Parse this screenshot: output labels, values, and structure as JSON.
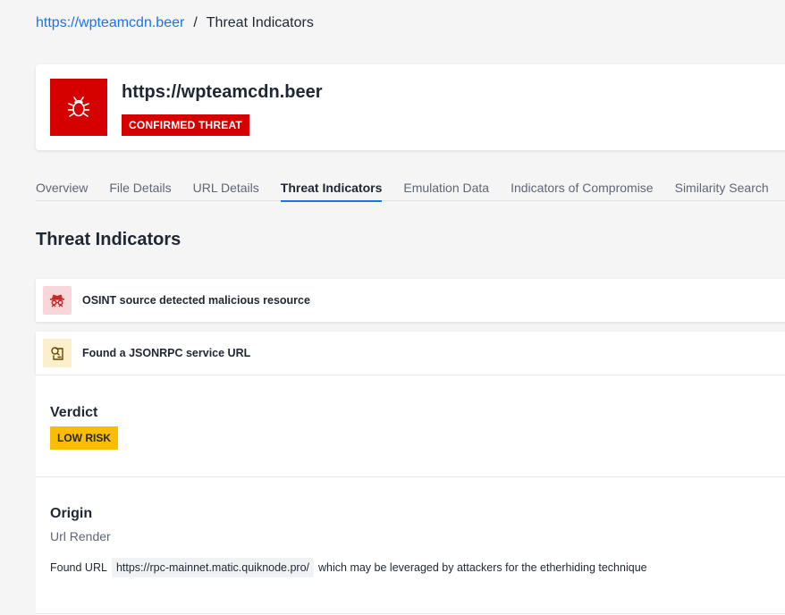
{
  "breadcrumb": {
    "link": "https://wpteamcdn.beer",
    "separator": "/",
    "current": "Threat Indicators"
  },
  "header": {
    "title": "https://wpteamcdn.beer",
    "badge": "CONFIRMED THREAT",
    "icon": "bug-icon",
    "badge_color": "#d50000"
  },
  "tabs": [
    {
      "label": "Overview",
      "active": false
    },
    {
      "label": "File Details",
      "active": false
    },
    {
      "label": "URL Details",
      "active": false
    },
    {
      "label": "Threat Indicators",
      "active": true
    },
    {
      "label": "Emulation Data",
      "active": false
    },
    {
      "label": "Indicators of Compromise",
      "active": false
    },
    {
      "label": "Similarity Search",
      "active": false
    }
  ],
  "section_title": "Threat Indicators",
  "indicators": [
    {
      "label": "OSINT source detected malicious resource",
      "icon": "spy-icon",
      "severity_color": "#f9d6d8"
    },
    {
      "label": "Found a JSONRPC service URL",
      "icon": "document-search-icon",
      "severity_color": "#fcefcc"
    }
  ],
  "detail": {
    "verdict_heading": "Verdict",
    "verdict_badge": "LOW RISK",
    "verdict_color": "#fbbc04",
    "origin_heading": "Origin",
    "origin_sub": "Url Render",
    "found_prefix": "Found URL",
    "found_url": "https://rpc-mainnet.matic.quiknode.pro/",
    "found_suffix": "which may be leveraged by attackers for the etherhiding technique"
  },
  "accent_color": "#1a73e8"
}
